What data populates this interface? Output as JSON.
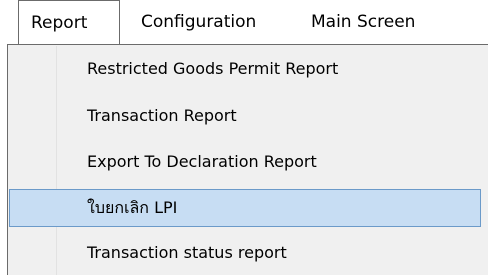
{
  "menubar": {
    "items": [
      {
        "label": "Report"
      },
      {
        "label": "Configuration"
      },
      {
        "label": "Main Screen"
      }
    ]
  },
  "dropdown": {
    "items": [
      {
        "label": "Restricted Goods Permit Report"
      },
      {
        "label": "Transaction Report"
      },
      {
        "label": "Export To Declaration Report"
      },
      {
        "label": "ใบยกเลิก LPI",
        "highlighted": true
      },
      {
        "label": "Transaction status report"
      }
    ]
  },
  "colors": {
    "menu_background": "#f0f0f0",
    "highlight_fill": "#c7ddf3",
    "highlight_border": "#6b9ac9",
    "border": "#6b6b6b"
  }
}
